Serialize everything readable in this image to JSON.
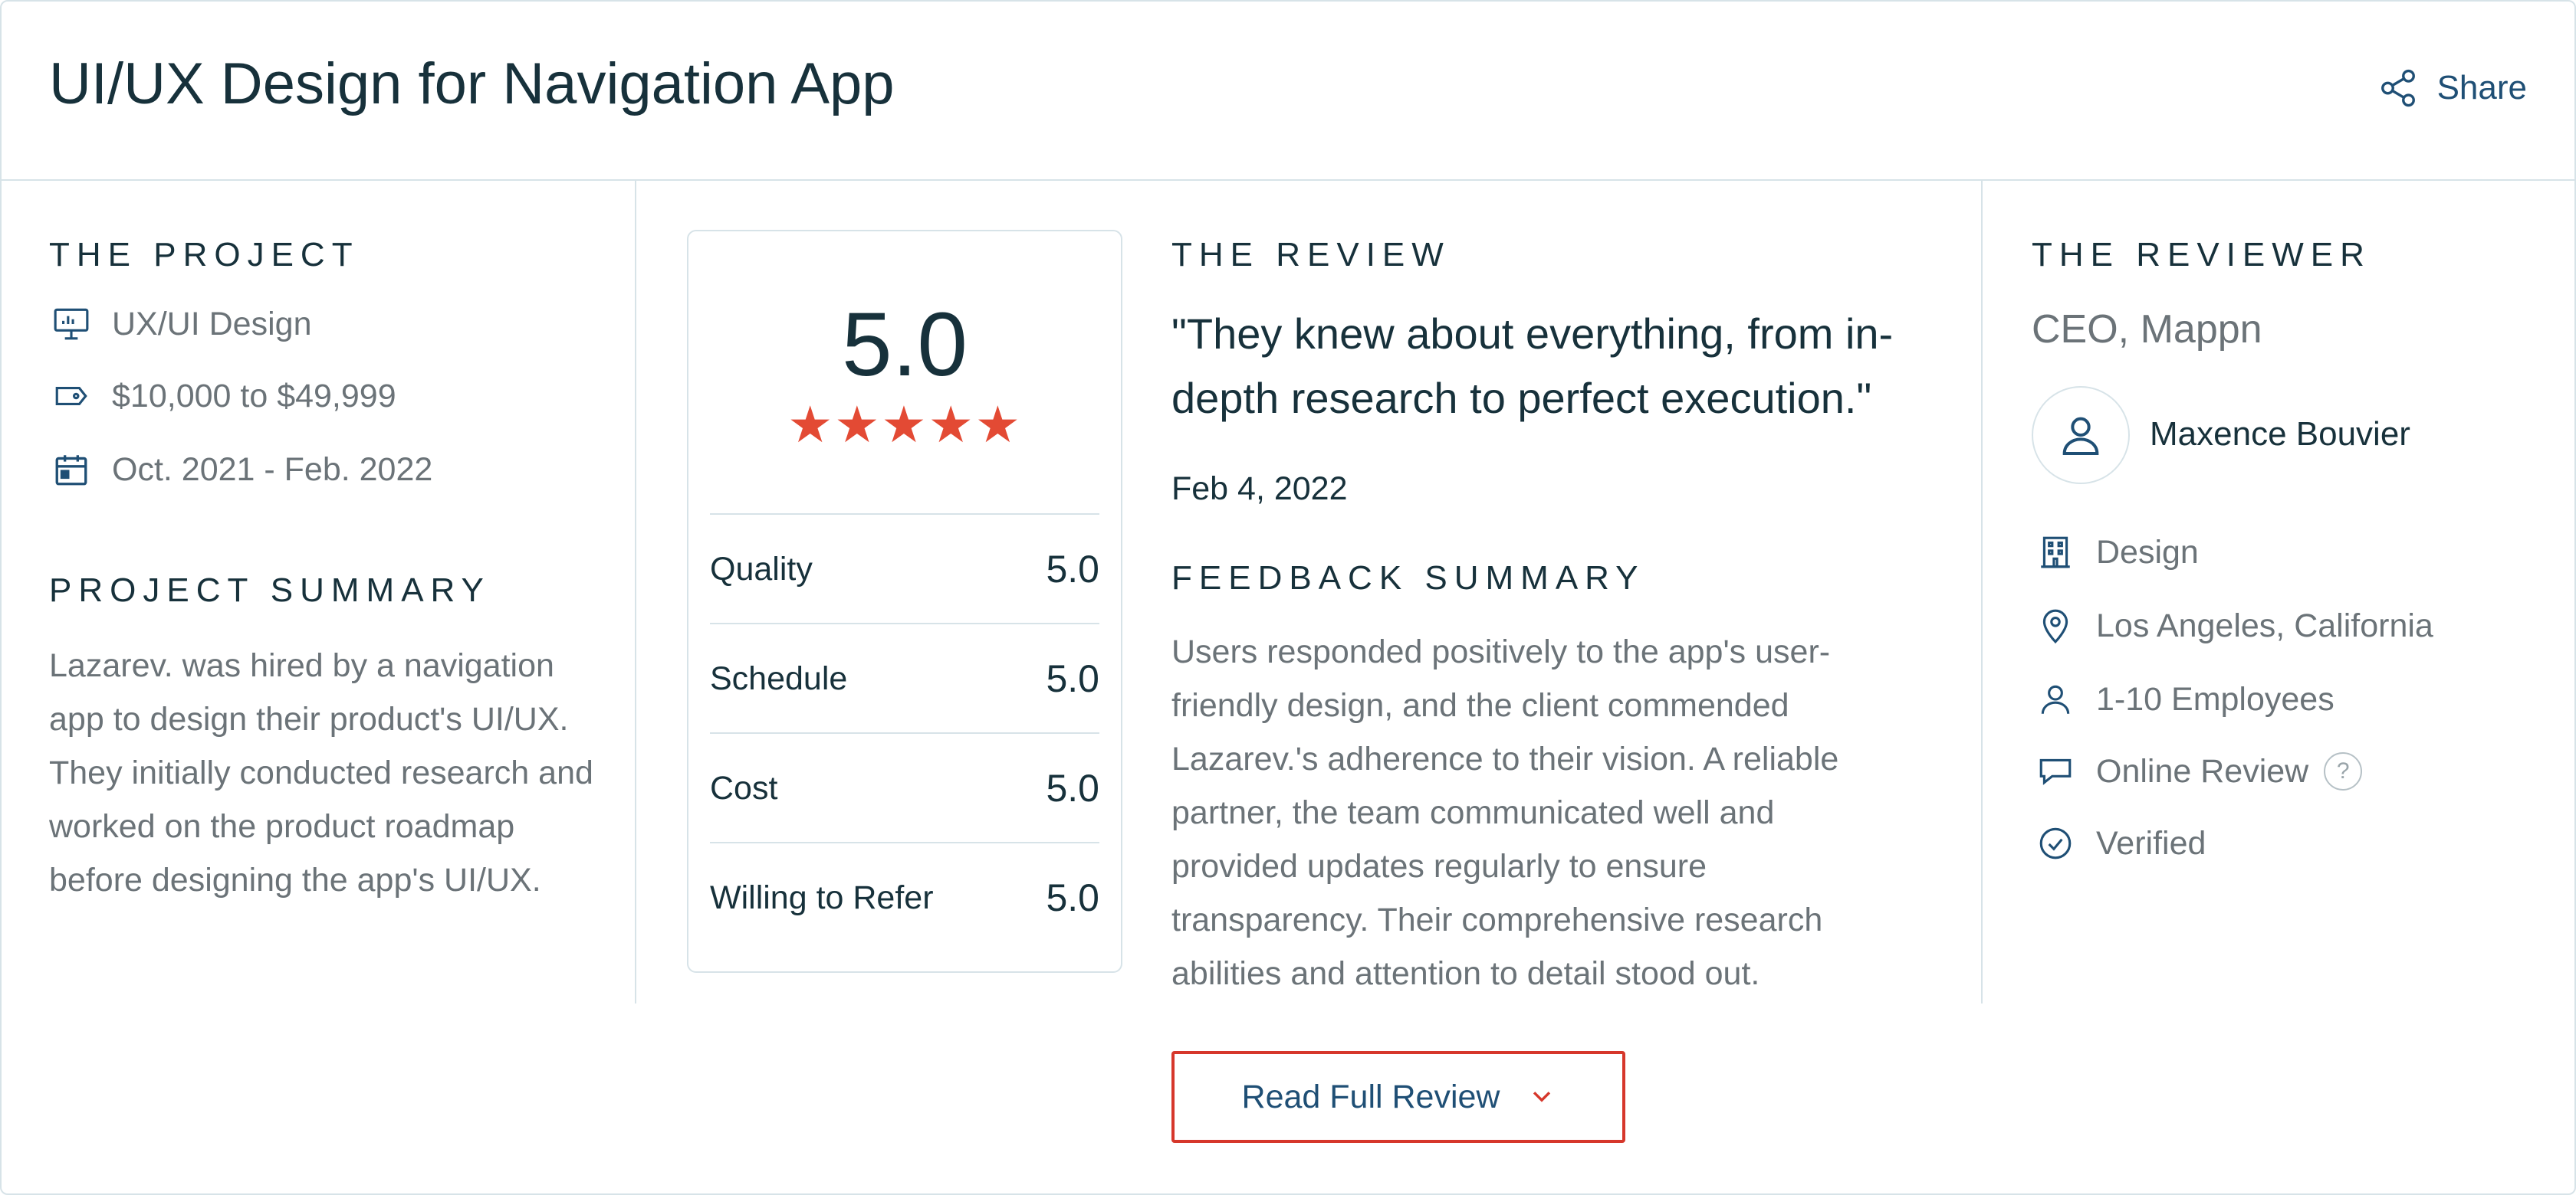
{
  "header": {
    "title": "UI/UX Design for Navigation App",
    "share_label": "Share"
  },
  "project": {
    "heading": "THE PROJECT",
    "service": "UX/UI Design",
    "budget": "$10,000 to $49,999",
    "dates": "Oct. 2021 - Feb. 2022",
    "summary_heading": "PROJECT SUMMARY",
    "summary": "Lazarev. was hired by a navigation app to design their product's UI/UX. They initially conducted research and worked on the product roadmap before designing the app's UI/UX."
  },
  "ratings": {
    "overall": "5.0",
    "stars": "★★★★★",
    "star_count": 5,
    "rows": [
      {
        "label": "Quality",
        "value": "5.0"
      },
      {
        "label": "Schedule",
        "value": "5.0"
      },
      {
        "label": "Cost",
        "value": "5.0"
      },
      {
        "label": "Willing to Refer",
        "value": "5.0"
      }
    ]
  },
  "review": {
    "heading": "THE REVIEW",
    "quote": "\"They knew about everything, from in-depth research to perfect execution.\"",
    "date": "Feb 4, 2022",
    "feedback_heading": "FEEDBACK SUMMARY",
    "feedback": "Users responded positively to the app's user-friendly design, and the client commended Lazarev.'s adherence to their vision. A reliable partner, the team communicated well and provided updates regularly to ensure transparency. Their comprehensive research abilities and attention to detail stood out."
  },
  "reviewer": {
    "heading": "THE REVIEWER",
    "role": "CEO, Mappn",
    "name": "Maxence Bouvier",
    "industry": "Design",
    "location": "Los Angeles, California",
    "size": "1-10 Employees",
    "review_type": "Online Review",
    "help_glyph": "?",
    "verified": "Verified"
  },
  "footer": {
    "read_full_label": "Read Full Review"
  },
  "colors": {
    "accent_red": "#e34a34",
    "link_blue": "#1f4f75",
    "border": "#d7e3e8"
  }
}
